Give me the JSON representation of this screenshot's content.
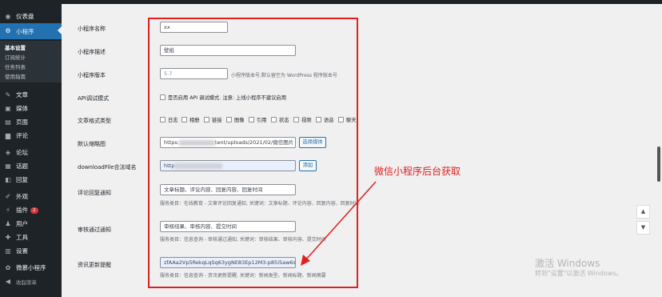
{
  "sidebar": {
    "items": [
      {
        "label": "仪表盘",
        "icon": "dashboard-icon",
        "glyph": "◉"
      },
      {
        "label": "小程序",
        "icon": "miniapp-icon",
        "glyph": "⚙"
      },
      {
        "label": "文章",
        "icon": "pin-icon",
        "glyph": "✎"
      },
      {
        "label": "媒体",
        "icon": "media-icon",
        "glyph": "▣"
      },
      {
        "label": "页面",
        "icon": "page-icon",
        "glyph": "▤"
      },
      {
        "label": "评论",
        "icon": "comment-icon",
        "glyph": "▆"
      },
      {
        "label": "论坛",
        "icon": "forum-icon",
        "glyph": "◈"
      },
      {
        "label": "话题",
        "icon": "topic-icon",
        "glyph": "▦"
      },
      {
        "label": "回复",
        "icon": "reply-icon",
        "glyph": "◧"
      },
      {
        "label": "外观",
        "icon": "appearance-icon",
        "glyph": "✐"
      },
      {
        "label": "插件",
        "icon": "plugin-icon",
        "glyph": "⚡",
        "badge": "2"
      },
      {
        "label": "用户",
        "icon": "user-icon",
        "glyph": "♟"
      },
      {
        "label": "工具",
        "icon": "tool-icon",
        "glyph": "✚"
      },
      {
        "label": "设置",
        "icon": "settings-icon",
        "glyph": "▥"
      },
      {
        "label": "微慕小程序",
        "icon": "weimu-icon",
        "glyph": "✿"
      },
      {
        "label": "收起菜单",
        "icon": "collapse-icon",
        "glyph": "◀"
      }
    ],
    "submenu": [
      "基本设置",
      "订阅统计",
      "任务列表",
      "使用指南"
    ]
  },
  "form": {
    "name_label": "小程序名称",
    "name_value": "xx",
    "desc_label": "小程序描述",
    "desc_value": "壁纸",
    "version_label": "小程序版本",
    "version_value": "5.7",
    "version_desc": "小程序版本号,默认留空为 WordPress 程序版本号",
    "api_label": "API调试模式",
    "api_check": "是否启用 API 调试模式. 注意: 上线小程序不建议启用",
    "format_label": "文章格式类型",
    "formats": [
      "日志",
      "相册",
      "链接",
      "图像",
      "引用",
      "状态",
      "视频",
      "语音",
      "聊天"
    ],
    "thumb_label": "默认缩略图",
    "thumb_prefix": "https:",
    "thumb_suffix": "tent/uploads/2021/02/微信图片",
    "thumb_button": "选择媒体",
    "download_label": "downloadFile合法域名",
    "download_prefix": "http",
    "download_button": "添加",
    "comment_label": "评论回复通知",
    "comment_value": "文章标题、评论内容、回复内容、回复时间",
    "comment_desc": "服务类目：在线教育 - 文章评论回复通知, 关键词：文章标题、评论内容、回复内容、回复时间",
    "audit_label": "审核通过通知",
    "audit_value": "审核结果、审核内容、提交时间",
    "audit_desc": "服务类目：信息查询 - 审核通过通知, 关键词：审核结果、审核内容、提交时间",
    "update_label": "资讯更新提醒",
    "update_value": "zfAAa2Vp5RekqLqSq63ygNE83Ep12M3-p85i5aw6scQ",
    "update_desc": "服务类目：信息查询 - 资讯更新提醒, 关键词：新闻类型、新闻标题、新闻摘要"
  },
  "annotation": {
    "text": "微信小程序后台获取",
    "color": "#e02020"
  },
  "nav": {
    "up": "▲",
    "down": "▼"
  },
  "watermark": {
    "line1": "激活 Windows",
    "line2": "转到\"设置\"以激活 Windows。"
  }
}
